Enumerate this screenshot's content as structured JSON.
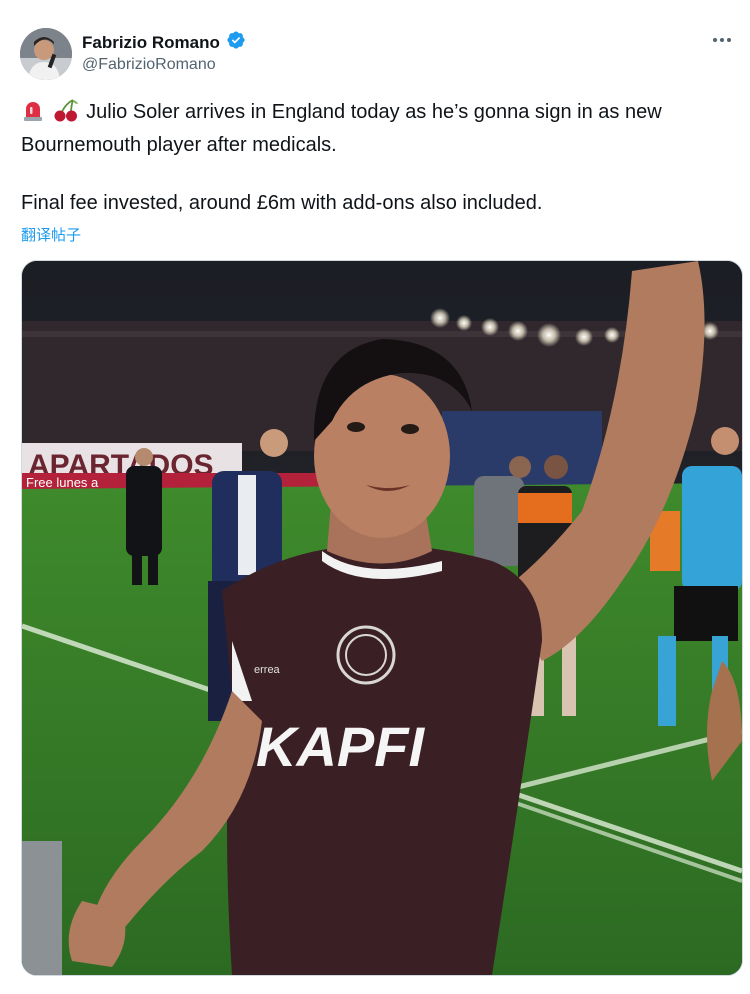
{
  "author": {
    "display_name": "Fabrizio Romano",
    "handle": "@FabrizioRomano",
    "verified_icon": "verified-badge-icon",
    "badge_color": "#1d9bf0"
  },
  "tweet": {
    "line1": "Julio Soler arrives in England today as he’s gonna sign in as new",
    "line2": "Bournemouth player after medicals.",
    "line3": "Final fee invested, around £6m with add-ons also included.",
    "emoji_1": "siren-icon",
    "emoji_2": "cherries-icon",
    "translate_label": "翻译帖子"
  },
  "media": {
    "banner_text": "APARTADOS",
    "banner_text_2": "Free  lunes a",
    "jersey_sponsor": "KAPFI",
    "jersey_brand": "errea"
  },
  "colors": {
    "link": "#1d9bf0",
    "secondary_text": "#536471",
    "jersey": "#3a1f25",
    "pitch": "#3b7a2a"
  }
}
